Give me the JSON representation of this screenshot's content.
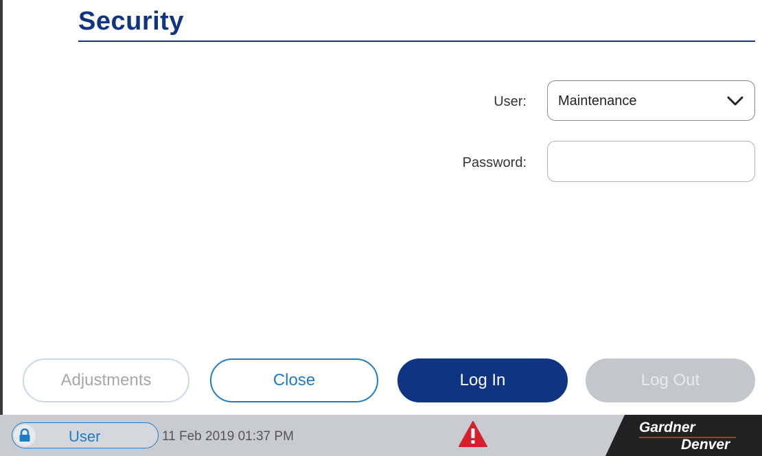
{
  "page": {
    "title": "Security"
  },
  "form": {
    "user_label": "User:",
    "user_value": "Maintenance",
    "password_label": "Password:",
    "password_value": ""
  },
  "buttons": {
    "adjustments": "Adjustments",
    "close": "Close",
    "login": "Log In",
    "logout": "Log Out"
  },
  "status": {
    "user_label": "User",
    "datetime": "11 Feb 2019  01:37 PM",
    "alert_icon": "warning-triangle-icon",
    "lock_icon": "lock-icon"
  },
  "brand": {
    "line1": "Gardner",
    "line2": "Denver"
  },
  "colors": {
    "primary": "#0f3582",
    "accent": "#1e7bc4",
    "alert": "#d6202e",
    "disabled": "#c3c7cb"
  }
}
